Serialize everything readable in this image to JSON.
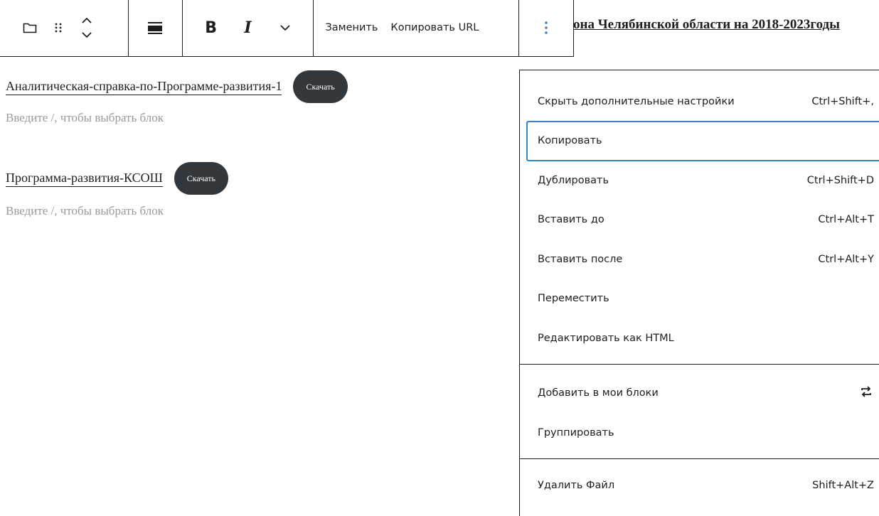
{
  "heading": {
    "text": "она Челябинской области на 2018-2023годы"
  },
  "toolbar": {
    "replace_label": "Заменить",
    "copy_url_label": "Копировать URL",
    "icons": [
      "folder-icon",
      "drag-handle-icon",
      "move-up-down-icon",
      "align-icon",
      "bold-icon",
      "italic-icon",
      "chevron-down-icon",
      "more-options-icon"
    ],
    "bold_glyph": "B",
    "italic_glyph": "I"
  },
  "blocks": [
    {
      "file_name": "Аналитическая-справка-по-Программе-развития-1",
      "download_label": "Скачать",
      "placeholder": "Введите /, чтобы выбрать блок"
    },
    {
      "file_name": "Программа-развития-КСОШ",
      "download_label": "Скачать",
      "placeholder": "Введите /, чтобы выбрать блок"
    }
  ],
  "menu": {
    "section1": [
      {
        "label": "Скрыть дополнительные настройки",
        "shortcut": "Ctrl+Shift+,"
      },
      {
        "label": "Копировать",
        "shortcut": ""
      },
      {
        "label": "Дублировать",
        "shortcut": "Ctrl+Shift+D"
      },
      {
        "label": "Вставить до",
        "shortcut": "Ctrl+Alt+T"
      },
      {
        "label": "Вставить после",
        "shortcut": "Ctrl+Alt+Y"
      },
      {
        "label": "Переместить",
        "shortcut": ""
      },
      {
        "label": "Редактировать как HTML",
        "shortcut": ""
      }
    ],
    "section2": [
      {
        "label": "Добавить в мои блоки",
        "icon": "reusable-block-icon"
      },
      {
        "label": "Группировать"
      }
    ],
    "section3": [
      {
        "label": "Удалить Файл",
        "shortcut": "Shift+Alt+Z"
      }
    ],
    "focus_color": "#3582c4"
  },
  "colors": {
    "button_bg": "#32373c",
    "text": "#1e1e1e",
    "placeholder": "#9a9a9a"
  }
}
